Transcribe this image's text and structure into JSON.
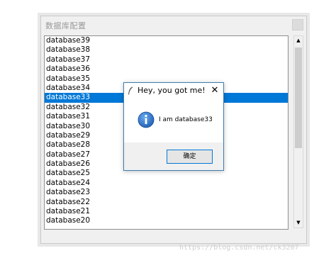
{
  "window": {
    "group_title": "数据库配置"
  },
  "list": {
    "items": [
      "database39",
      "database38",
      "database37",
      "database36",
      "database35",
      "database34",
      "database33",
      "database32",
      "database31",
      "database30",
      "database29",
      "database28",
      "database27",
      "database26",
      "database25",
      "database24",
      "database23",
      "database22",
      "database21",
      "database20"
    ],
    "selected": "database33"
  },
  "dialog": {
    "title": "Hey, you got me!",
    "close_glyph": "✕",
    "message": "I am database33",
    "ok_label": "确定"
  },
  "scrollbar": {
    "up_arrow": "▲",
    "down_arrow": "▼"
  },
  "watermark": "https://blog.csdn.net/ck3207",
  "colors": {
    "selection": "#0078d7",
    "dialog_border": "#3c7fb1",
    "info_icon": "#1f5fb5"
  }
}
